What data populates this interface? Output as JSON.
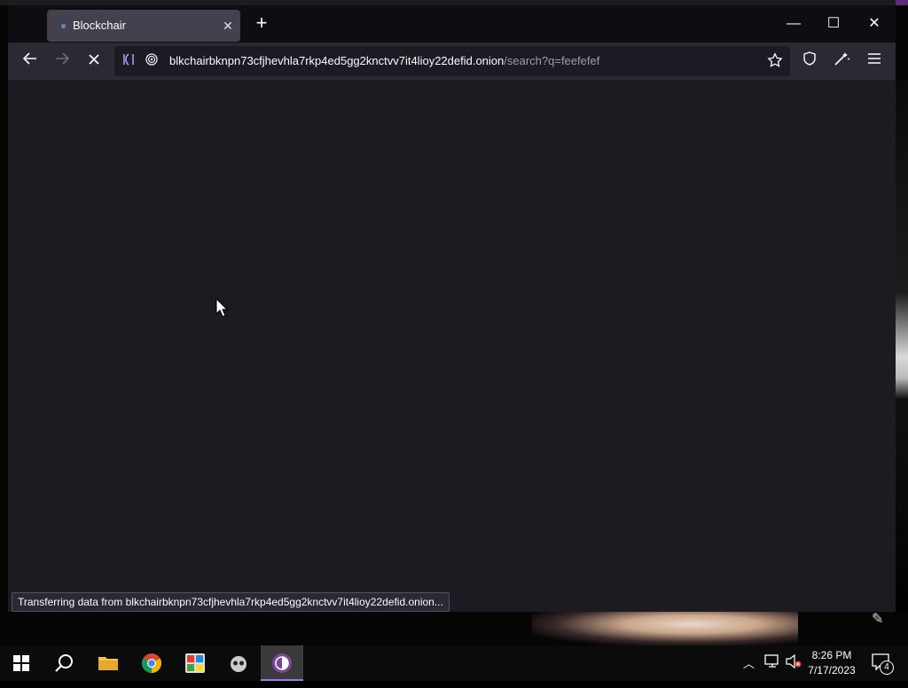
{
  "browser": {
    "tab": {
      "title": "Blockchair"
    },
    "address": {
      "host": "blkchairbknpn73cfjhevhla7rkp4ed5gg2knctvv7it4lioy22defid.onion",
      "path": "/search?q=feefefef"
    },
    "status_text": "Transferring data from blkchairbknpn73cfjhevhla7rkp4ed5gg2knctvv7it4lioy22defid.onion..."
  },
  "taskbar": {
    "clock_time": "8:26 PM",
    "clock_date": "7/17/2023",
    "notifications_count": "4",
    "apps": [
      "start-button",
      "search-button",
      "file-explorer",
      "chrome",
      "paint",
      "app-icon",
      "tor-browser"
    ]
  },
  "icons": {
    "back": "arrow-left",
    "forward": "arrow-right",
    "stop": "x",
    "bookmark": "star",
    "shield": "shield",
    "extensions": "wand",
    "menu": "hamburger"
  },
  "colors": {
    "tab_bg": "#42414d",
    "content_bg": "#1c1b22",
    "navbar_bg": "#2b2a33",
    "tor_accent": "#7d4698"
  }
}
